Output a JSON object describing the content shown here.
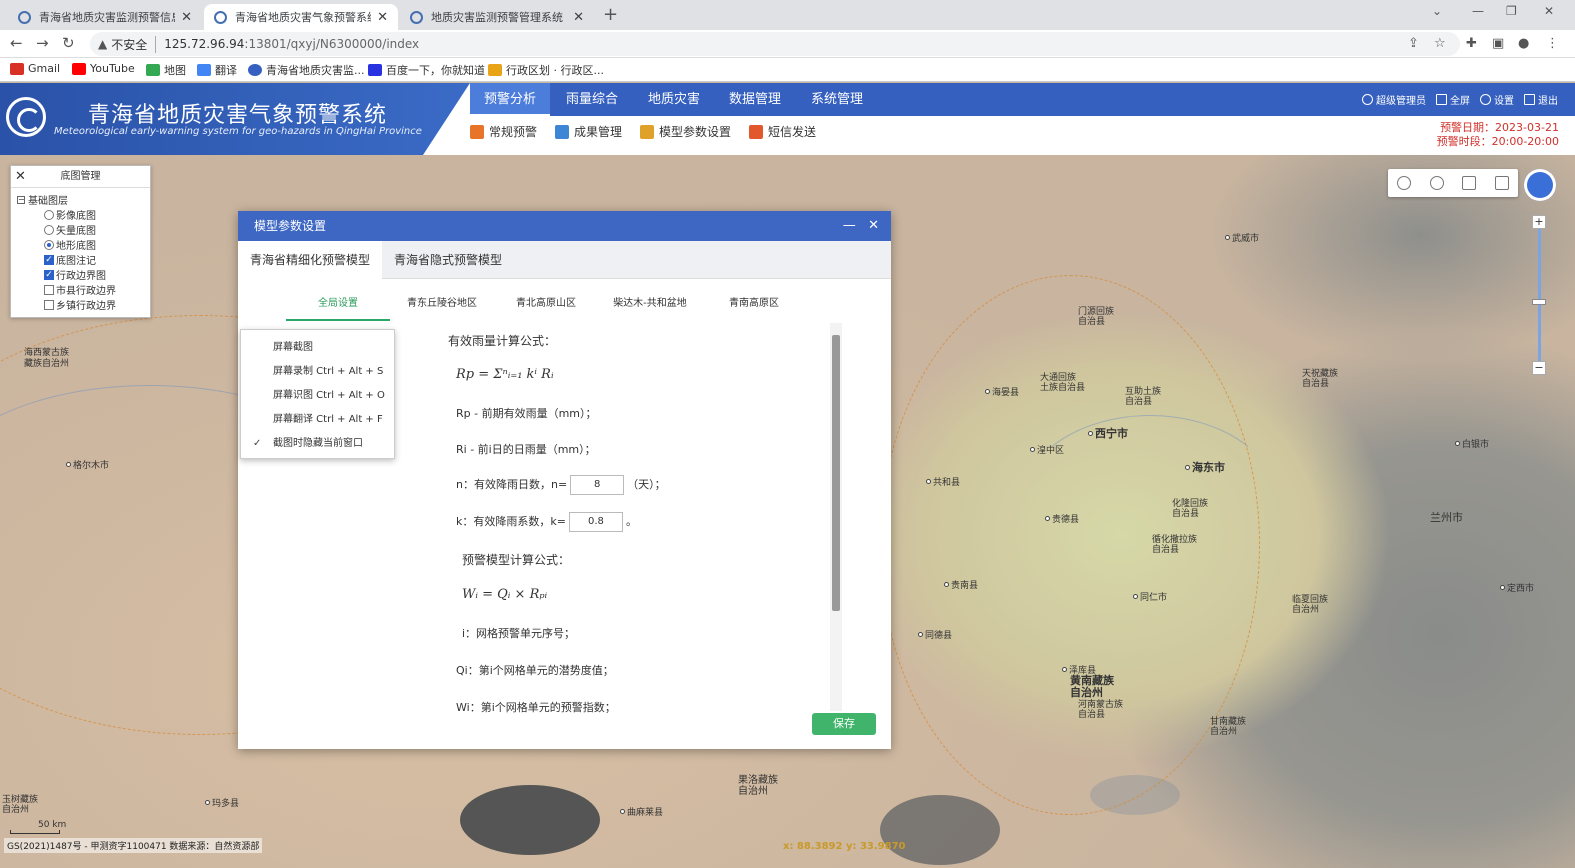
{
  "browser": {
    "tabs": [
      {
        "title": "青海省地质灾害监测预警信息化…",
        "active": false
      },
      {
        "title": "青海省地质灾害气象预警系统",
        "active": true
      },
      {
        "title": "地质灾害监测预警管理系统",
        "active": false
      }
    ],
    "url_host": "125.72.96.94",
    "url_port_path": ":13801/qxyj/N6300000/index",
    "security": "不安全",
    "bookmarks": [
      {
        "label": "Gmail",
        "color": "#d93025"
      },
      {
        "label": "YouTube",
        "color": "#ff0000"
      },
      {
        "label": "地图",
        "color": "#34a853"
      },
      {
        "label": "翻译",
        "color": "#4285f4"
      },
      {
        "label": "青海省地质灾害监...",
        "color": "#3660c0"
      },
      {
        "label": "百度一下，你就知道",
        "color": "#2932e1"
      },
      {
        "label": "行政区划 · 行政区...",
        "color": "#e8a317"
      }
    ]
  },
  "app": {
    "title": "青海省地质灾害气象预警系统",
    "subtitle": "Meteorological early-warning system for geo-hazards in QingHai Province",
    "nav": [
      "预警分析",
      "雨量综合",
      "地质灾害",
      "数据管理",
      "系统管理"
    ],
    "nav_active": "预警分析",
    "subnav": [
      "常规预警",
      "成果管理",
      "模型参数设置",
      "短信发送"
    ],
    "user_actions": [
      "超级管理员",
      "全屏",
      "设置",
      "退出"
    ],
    "warning_date_label": "预警日期：2023-03-21",
    "warning_period_label": "预警时段：20:00-20:00"
  },
  "layer_panel": {
    "title": "底图管理",
    "root": "基础图层",
    "items": [
      {
        "label": "影像底图",
        "type": "radio",
        "checked": false
      },
      {
        "label": "矢量底图",
        "type": "radio",
        "checked": false
      },
      {
        "label": "地形底图",
        "type": "radio",
        "checked": true
      },
      {
        "label": "底图注记",
        "type": "checkbox",
        "checked": true
      },
      {
        "label": "行政边界图",
        "type": "checkbox",
        "checked": true
      },
      {
        "label": "市县行政边界",
        "type": "checkbox",
        "checked": false
      },
      {
        "label": "乡镇行政边界",
        "type": "checkbox",
        "checked": false
      }
    ]
  },
  "dialog": {
    "title": "模型参数设置",
    "tabs": [
      "青海省精细化预警模型",
      "青海省隐式预警模型"
    ],
    "active_tab": "青海省精细化预警模型",
    "region_tabs": [
      "全局设置",
      "青东丘陵谷地区",
      "青北高原山区",
      "柴达木-共和盆地",
      "青南高原区"
    ],
    "active_region": "全局设置",
    "heading1": "有效雨量计算公式：",
    "formula1": "Rp = Σⁿᵢ₌₁ kⁱ Rᵢ",
    "rp_desc": "Rp - 前期有效雨量（mm）；",
    "ri_desc": "Ri - 前i日的日雨量（mm）；",
    "n_label": "n：有效降雨日数，n=",
    "n_value": "8",
    "n_unit": "（天）；",
    "k_label": "k：有效降雨系数，k=",
    "k_value": "0.8",
    "k_unit": "。",
    "heading2": "预警模型计算公式：",
    "formula2": "Wᵢ = Qᵢ × Rₚᵢ",
    "i_desc": "i：网格预警单元序号；",
    "qi_desc": "Qi：第i个网格单元的潜势度值；",
    "wi_desc": "Wi：第i个网格单元的预警指数；",
    "save_label": "保存"
  },
  "context_menu": {
    "items": [
      {
        "label": "屏幕截图",
        "checked": false
      },
      {
        "label": "屏幕录制 Ctrl + Alt + S",
        "checked": false
      },
      {
        "label": "屏幕识图 Ctrl + Alt + O",
        "checked": false
      },
      {
        "label": "屏幕翻译 Ctrl + Alt + F",
        "checked": false
      },
      {
        "label": "截图时隐藏当前窗口",
        "checked": true
      }
    ]
  },
  "map": {
    "places": [
      {
        "label": "海西蒙古族\n藏族自治州",
        "big": false
      },
      {
        "label": "格尔木市",
        "big": false
      },
      {
        "label": "西宁市",
        "big": true
      },
      {
        "label": "海东市",
        "big": true
      },
      {
        "label": "兰州市",
        "big": false
      },
      {
        "label": "武威市",
        "big": false
      },
      {
        "label": "门源回族\n自治县",
        "big": false
      },
      {
        "label": "海晏县",
        "big": false
      },
      {
        "label": "大通回族\n土族自治县",
        "big": false
      },
      {
        "label": "互助土族\n自治县",
        "big": false
      },
      {
        "label": "湟中区",
        "big": false
      },
      {
        "label": "共和县",
        "big": false
      },
      {
        "label": "贵德县",
        "big": false
      },
      {
        "label": "化隆回族\n自治县",
        "big": false
      },
      {
        "label": "循化撒拉族\n自治县",
        "big": false
      },
      {
        "label": "贵南县",
        "big": false
      },
      {
        "label": "同仁市",
        "big": false
      },
      {
        "label": "同德县",
        "big": false
      },
      {
        "label": "泽库县",
        "big": false
      },
      {
        "label": "黄南藏族\n自治州",
        "big": true
      },
      {
        "label": "河南蒙古族\n自治县",
        "big": false
      },
      {
        "label": "甘南藏族\n自治州",
        "big": false
      },
      {
        "label": "果洛藏族\n自治州",
        "big": false
      },
      {
        "label": "玛多县",
        "big": false
      },
      {
        "label": "白银市",
        "big": false
      },
      {
        "label": "定西市",
        "big": false
      },
      {
        "label": "临夏回族\n自治州",
        "big": false
      },
      {
        "label": "天祝藏族\n自治县",
        "big": false
      },
      {
        "label": "曲麻莱县",
        "big": false
      },
      {
        "label": "玉树藏族\n自治州",
        "big": false
      }
    ],
    "footer": "GS(2021)1487号 - 甲测资字1100471 数据来源：自然资源部",
    "coords": "x: 88.3892  y: 33.9870",
    "scale_label": "50 km"
  }
}
